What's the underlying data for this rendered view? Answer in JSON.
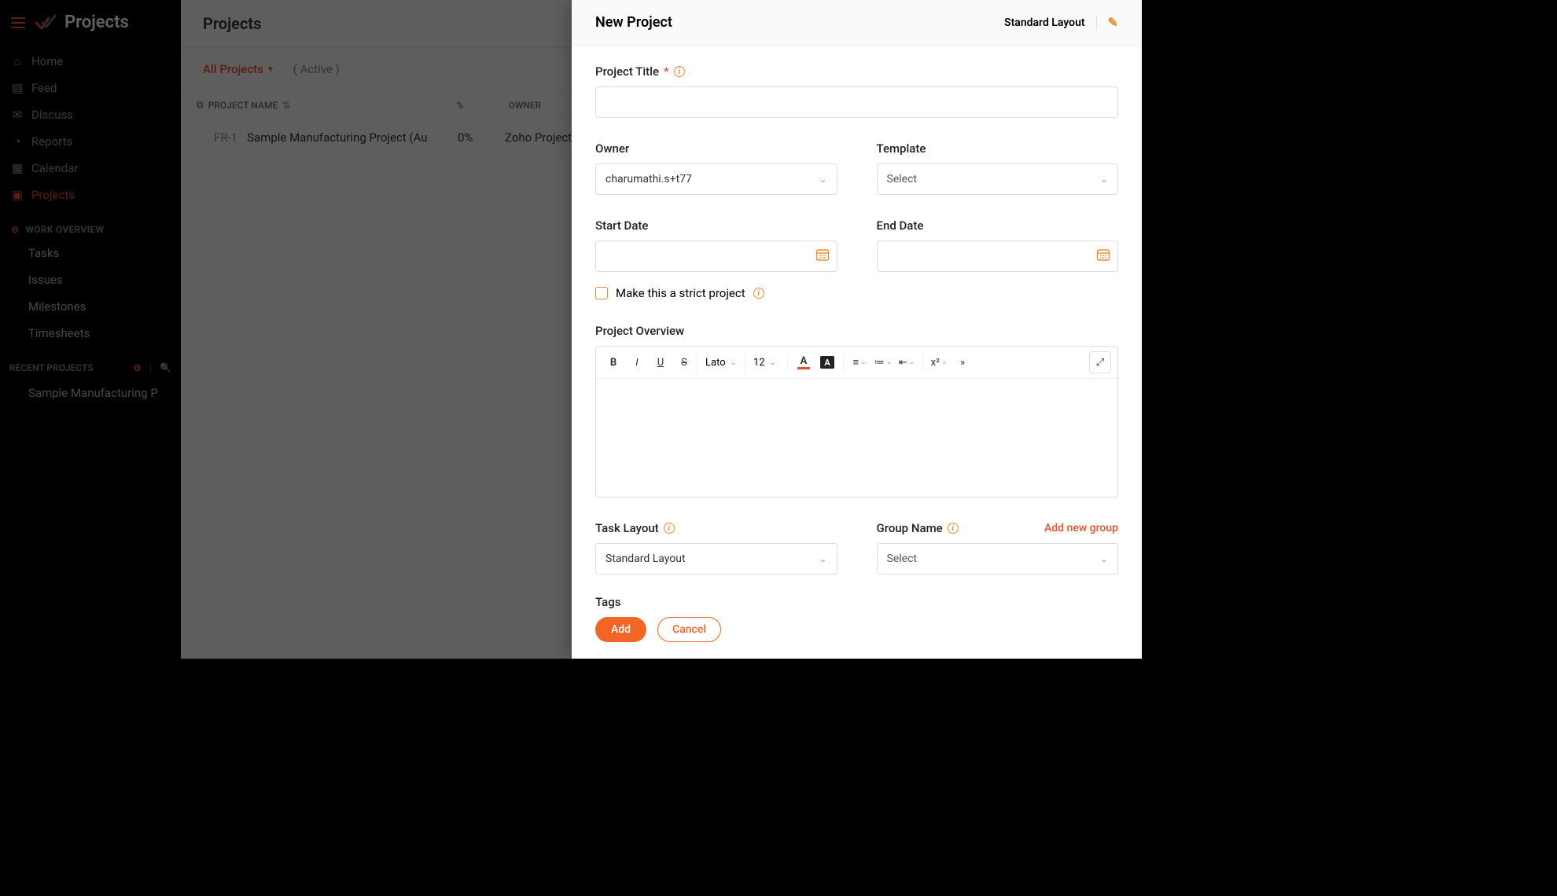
{
  "app": {
    "name": "Projects"
  },
  "sidebar": {
    "items": [
      {
        "label": "Home"
      },
      {
        "label": "Feed"
      },
      {
        "label": "Discuss"
      },
      {
        "label": "Reports"
      },
      {
        "label": "Calendar"
      },
      {
        "label": "Projects"
      }
    ],
    "work_overview_header": "WORK OVERVIEW",
    "work_items": [
      {
        "label": "Tasks"
      },
      {
        "label": "Issues"
      },
      {
        "label": "Milestones"
      },
      {
        "label": "Timesheets"
      }
    ],
    "recent_header": "RECENT PROJECTS",
    "recent_items": [
      {
        "label": "Sample Manufacturing P"
      }
    ]
  },
  "main": {
    "title": "Projects",
    "filter_all": "All Projects",
    "filter_active": "( Active )",
    "columns": {
      "name": "PROJECT NAME",
      "pct": "%",
      "owner": "OWNER"
    },
    "rows": [
      {
        "code": "FR-1",
        "name": "Sample Manufacturing Project (Au",
        "pct": "0%",
        "owner": "Zoho Project"
      }
    ]
  },
  "drawer": {
    "title": "New Project",
    "layout_text": "Standard Layout",
    "labels": {
      "project_title": "Project Title",
      "owner": "Owner",
      "template": "Template",
      "start_date": "Start Date",
      "end_date": "End Date",
      "strict": "Make this a strict project",
      "overview": "Project Overview",
      "task_layout": "Task Layout",
      "group_name": "Group Name",
      "add_group": "Add new group",
      "tags": "Tags"
    },
    "values": {
      "owner": "charumathi.s+t77",
      "template": "Select",
      "task_layout": "Standard Layout",
      "group_name": "Select"
    },
    "editor": {
      "font_family": "Lato",
      "font_size": "12",
      "super": "x²"
    },
    "buttons": {
      "add": "Add",
      "cancel": "Cancel"
    }
  }
}
